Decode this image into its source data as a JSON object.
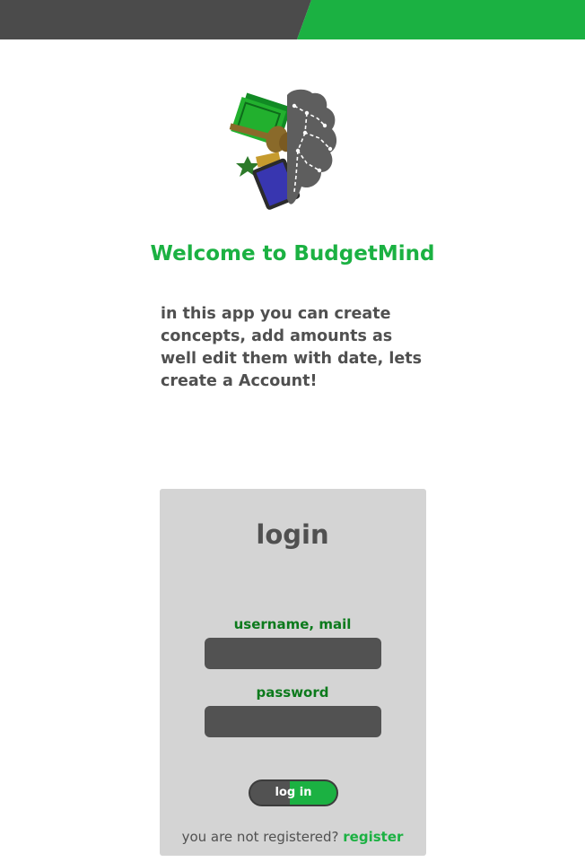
{
  "colors": {
    "brand_green": "#1bb142",
    "dark_gray": "#505050",
    "label_green": "#0c7a1c",
    "card_bg": "#d4d4d4",
    "input_bg": "#525252"
  },
  "header": {
    "logo_icon": "budgetmind-brain-money-logo-icon",
    "welcome": "Welcome to BudgetMind",
    "intro": "in this app you can create concepts, add amounts as well edit them with date, lets create a Account!"
  },
  "login": {
    "title": "login",
    "username_label": "username, mail",
    "username_value": "",
    "password_label": "password",
    "password_value": "",
    "submit_label": "log in",
    "not_registered_text": "you are not registered?",
    "register_link": "register"
  }
}
